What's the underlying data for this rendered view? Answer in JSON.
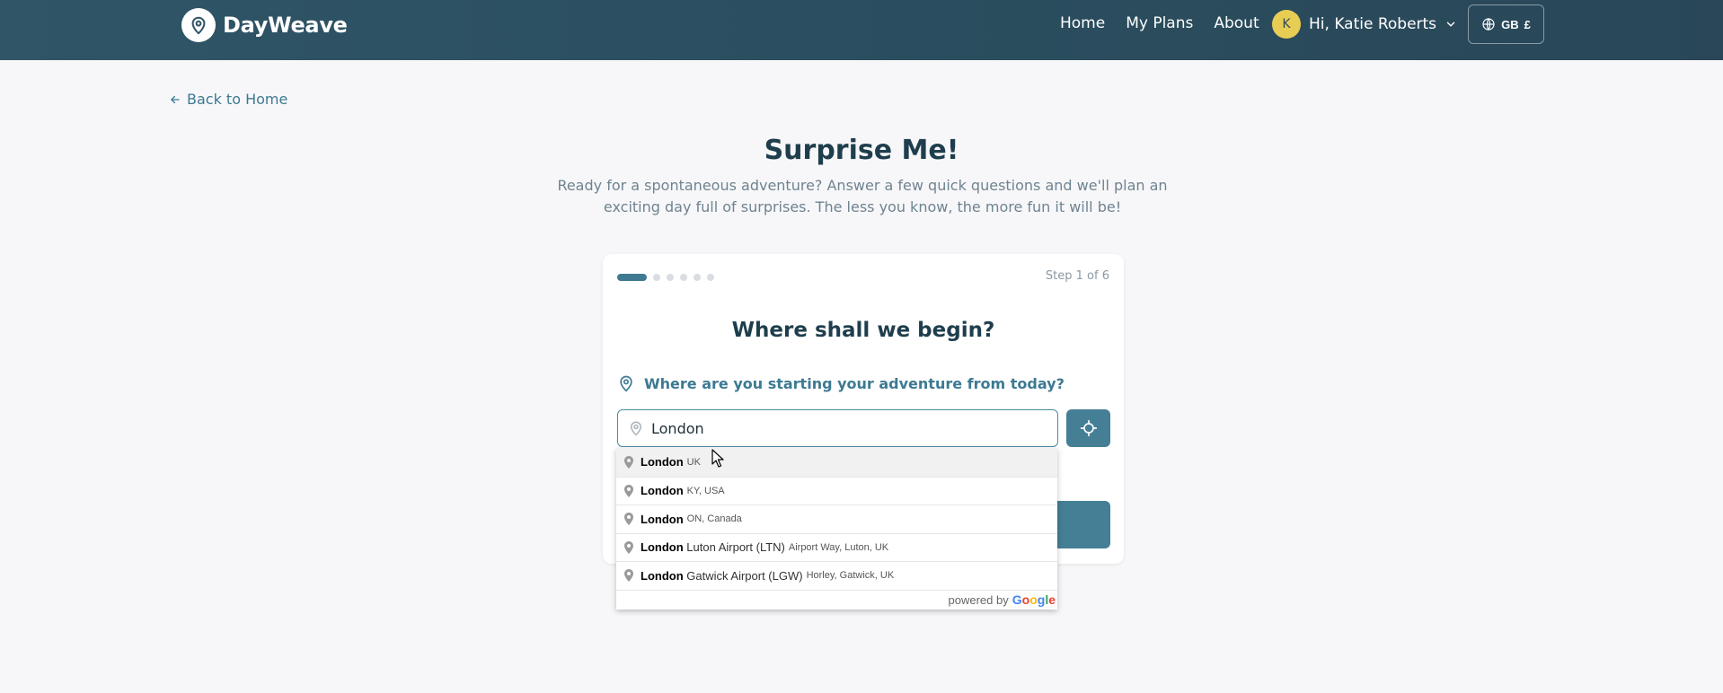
{
  "header": {
    "brand": "DayWeave",
    "nav": [
      "Home",
      "My Plans",
      "About"
    ],
    "user_initial": "K",
    "user_greeting": "Hi, Katie Roberts",
    "region": "GB",
    "currency": "£",
    "colors": {
      "accent": "#447f96",
      "avatar": "#e8cd55"
    }
  },
  "back_link": "Back to Home",
  "hero": {
    "title": "Surprise Me!",
    "subtitle": "Ready for a spontaneous adventure? Answer a few quick questions and we'll plan an exciting day full of surprises. The less you know, the more fun it will be!"
  },
  "card": {
    "step_label": "Step 1 of 6",
    "progress": {
      "current": 1,
      "total": 6
    },
    "title": "Where shall we begin?",
    "question": "Where are you starting your adventure from today?",
    "location_value": "London"
  },
  "autocomplete": {
    "items": [
      {
        "main": "London",
        "secondary": "UK"
      },
      {
        "main": "London",
        "secondary": "KY, USA"
      },
      {
        "main": "London",
        "secondary": "ON, Canada"
      },
      {
        "main": "London",
        "main_rest": "Luton Airport (LTN)",
        "secondary": "Airport Way, Luton, UK"
      },
      {
        "main": "London",
        "main_rest": "Gatwick Airport (LGW)",
        "secondary": "Horley, Gatwick, UK"
      }
    ],
    "powered_by": "powered by",
    "provider": "Google"
  }
}
